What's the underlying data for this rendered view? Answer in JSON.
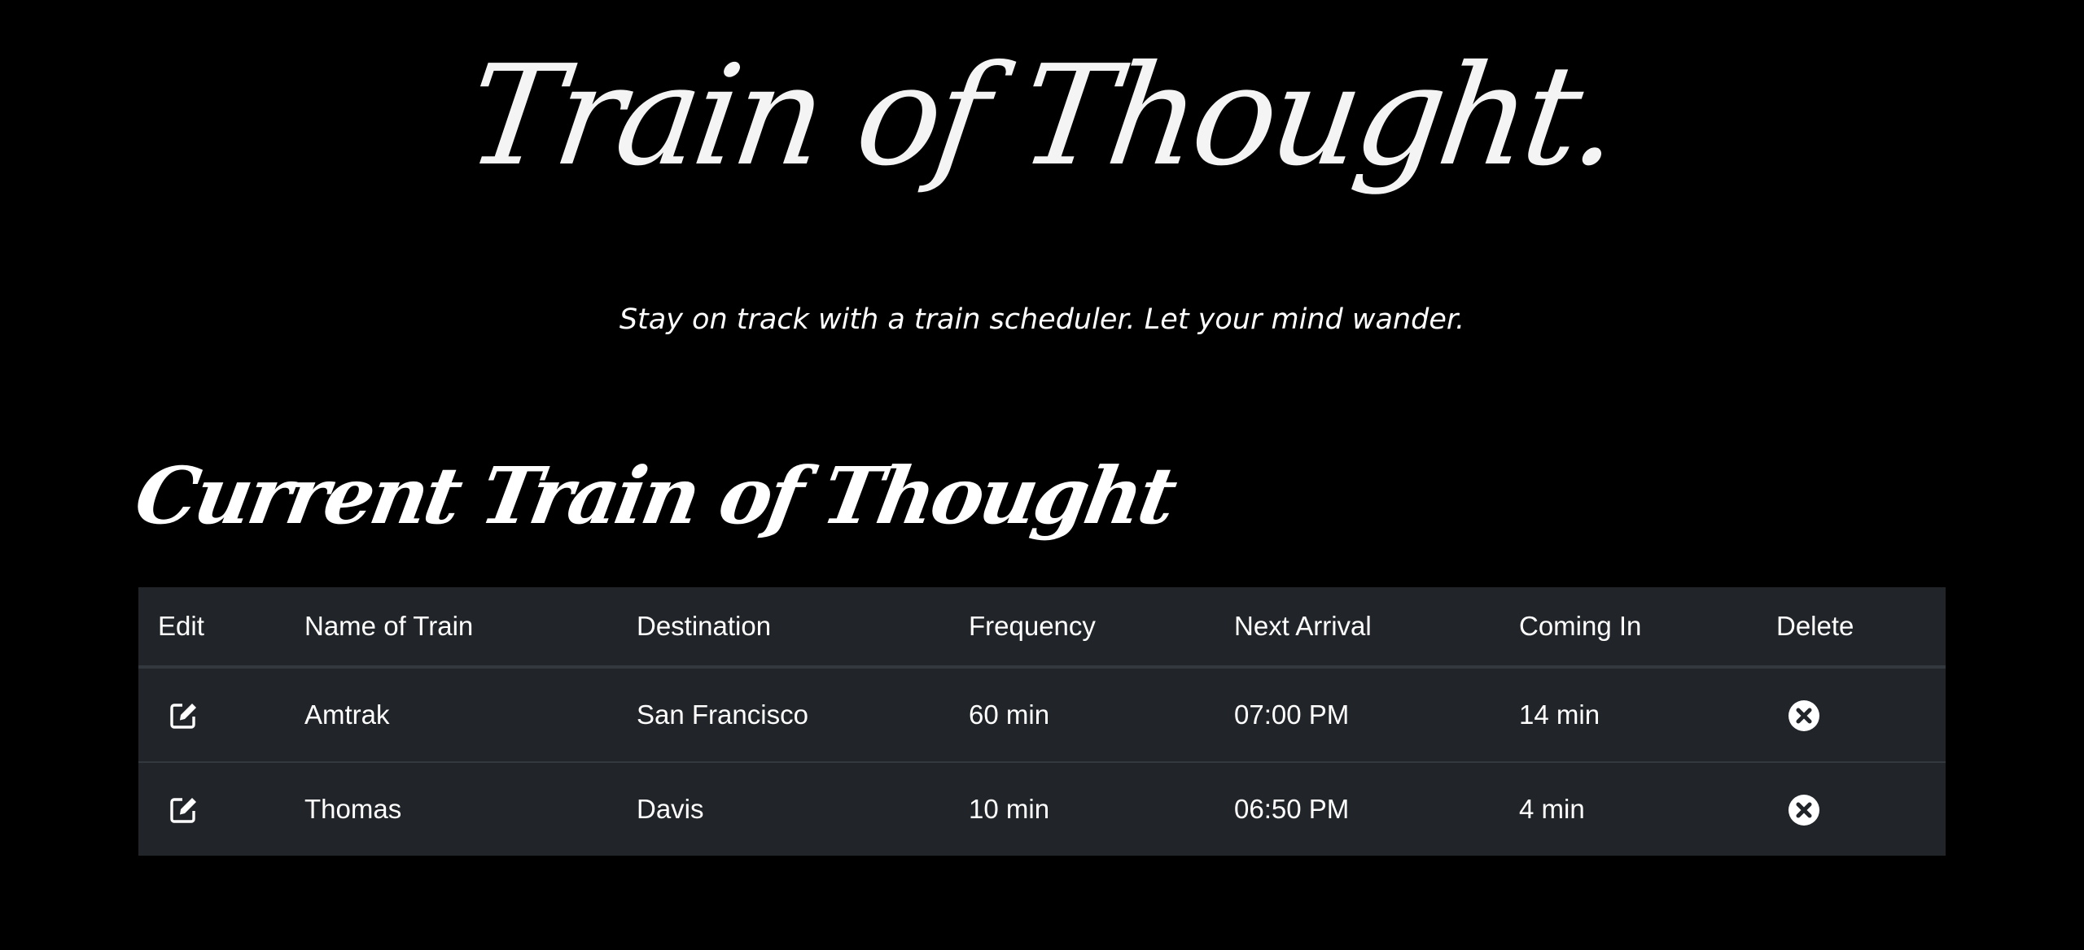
{
  "header": {
    "title": "Train of Thought.",
    "tagline": "Stay on track with a train scheduler. Let your mind wander."
  },
  "schedule": {
    "section_title": "Current Train of Thought",
    "columns": [
      "Edit",
      "Name of Train",
      "Destination",
      "Frequency",
      "Next Arrival",
      "Coming In",
      "Delete"
    ],
    "rows": [
      {
        "name": "Amtrak",
        "destination": "San Francisco",
        "frequency": "60 min",
        "next_arrival": "07:00 PM",
        "coming_in": "14 min"
      },
      {
        "name": "Thomas",
        "destination": "Davis",
        "frequency": "10 min",
        "next_arrival": "06:50 PM",
        "coming_in": "4 min"
      }
    ]
  },
  "icons": {
    "edit": "edit-icon",
    "delete": "times-circle-icon"
  },
  "colors": {
    "background": "#000000",
    "table_background": "#212529",
    "table_border": "#32383e",
    "text": "#ffffff"
  }
}
